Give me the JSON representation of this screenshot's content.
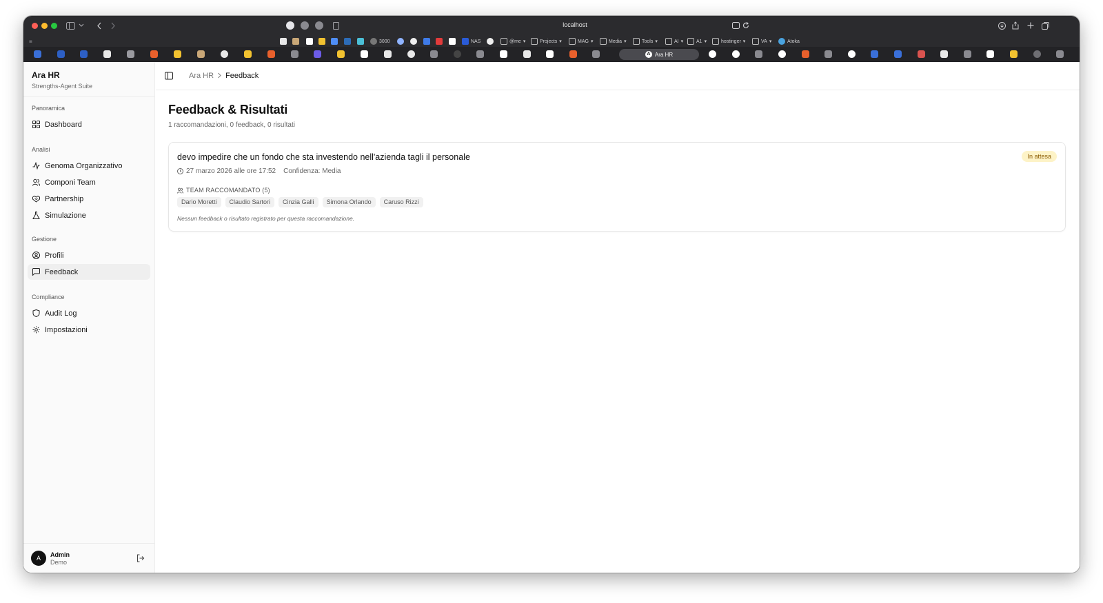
{
  "browser": {
    "url": "localhost",
    "bookmarks": [
      "3000",
      "NAS",
      "@me",
      "Projects",
      "MAG",
      "Media",
      "Tools",
      "AI",
      "A1",
      "hostinger",
      "VA",
      "Atoka"
    ],
    "active_tab": "Ara HR"
  },
  "app": {
    "name": "Ara HR",
    "tagline": "Strengths-Agent Suite"
  },
  "sidebar": {
    "groups": [
      {
        "label": "Panoramica",
        "items": [
          {
            "label": "Dashboard",
            "icon": "grid-icon"
          }
        ]
      },
      {
        "label": "Analisi",
        "items": [
          {
            "label": "Genoma Organizzativo",
            "icon": "activity-icon"
          },
          {
            "label": "Componi Team",
            "icon": "users-icon"
          },
          {
            "label": "Partnership",
            "icon": "handshake-icon"
          },
          {
            "label": "Simulazione",
            "icon": "flask-icon"
          }
        ]
      },
      {
        "label": "Gestione",
        "items": [
          {
            "label": "Profili",
            "icon": "user-circle-icon"
          },
          {
            "label": "Feedback",
            "icon": "message-icon",
            "active": true
          }
        ]
      },
      {
        "label": "Compliance",
        "items": [
          {
            "label": "Audit Log",
            "icon": "shield-icon"
          },
          {
            "label": "Impostazioni",
            "icon": "gear-icon"
          }
        ]
      }
    ],
    "user": {
      "initial": "A",
      "name": "Admin",
      "role": "Demo"
    }
  },
  "breadcrumb": {
    "parent": "Ara HR",
    "current": "Feedback"
  },
  "page": {
    "title": "Feedback & Risultati",
    "subtitle": "1 raccomandazioni, 0 feedback, 0 risultati"
  },
  "recommendation": {
    "title": "devo impedire che un fondo che sta investendo nell'azienda tagli il personale",
    "status": "In attesa",
    "date": "27 marzo 2026 alle ore 17:52",
    "confidence": "Confidenza: Media",
    "team_label": "TEAM RACCOMANDATO (5)",
    "team": [
      "Dario Moretti",
      "Claudio Sartori",
      "Cinzia Galli",
      "Simona Orlando",
      "Caruso Rizzi"
    ],
    "note": "Nessun feedback o risultato registrato per questa raccomandazione."
  },
  "colors": {
    "badge_bg": "#fdf3c7",
    "badge_text": "#8a5a00",
    "chrome_bg": "#2b2b2e"
  }
}
